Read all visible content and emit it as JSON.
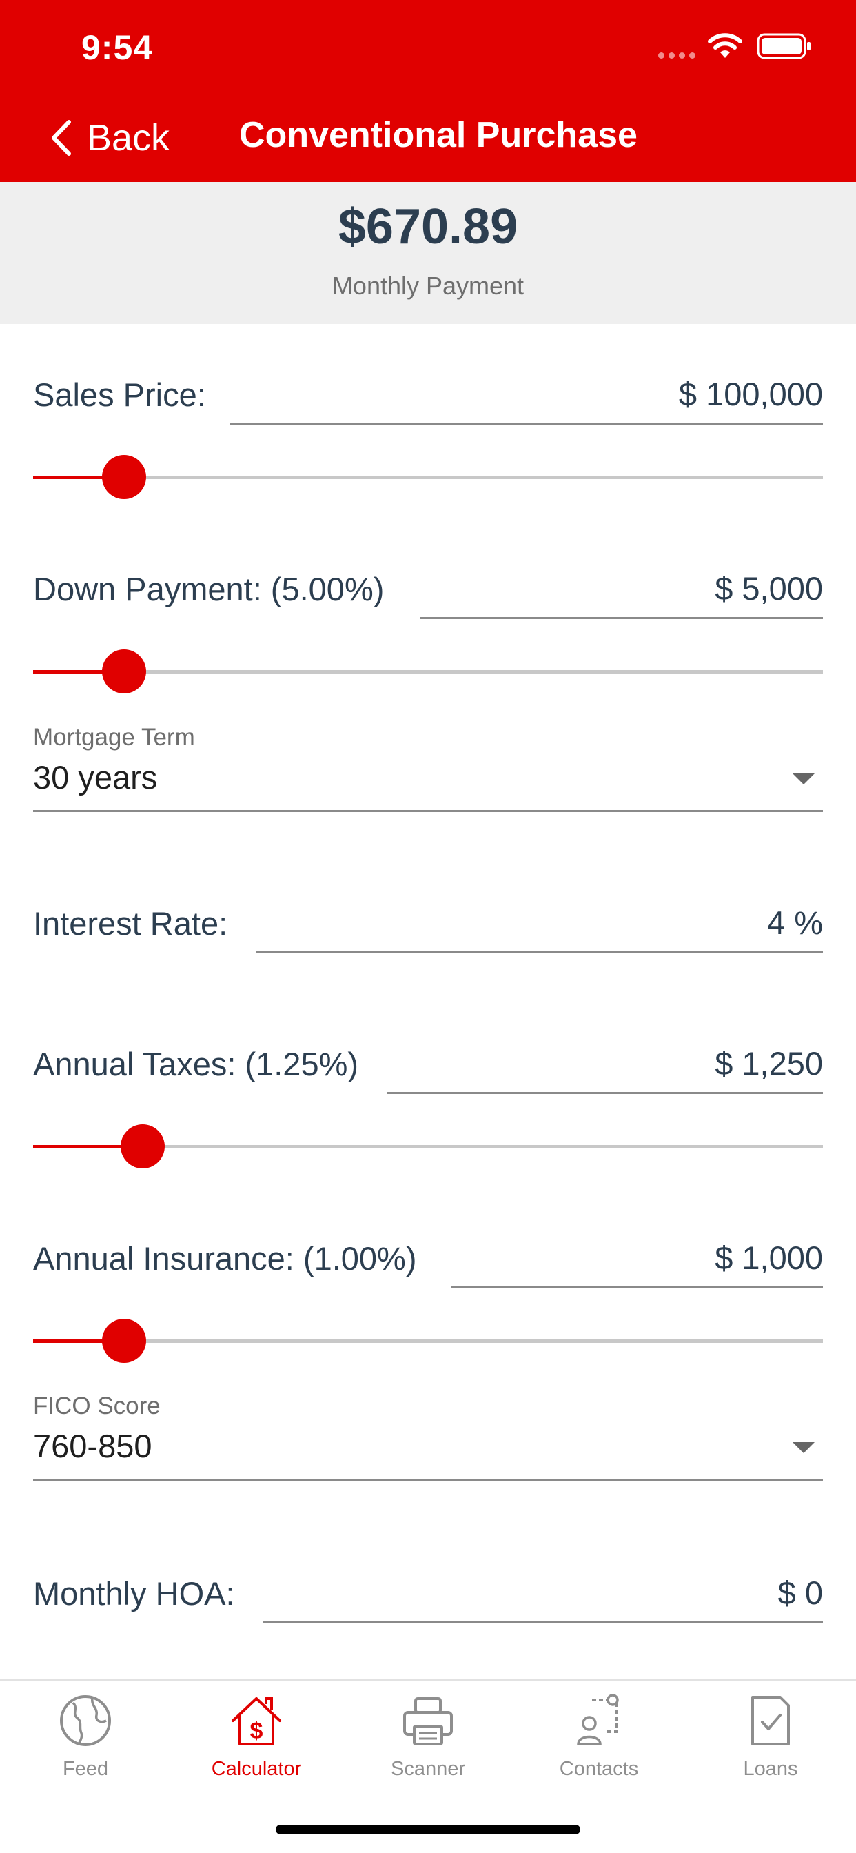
{
  "status_bar": {
    "time": "9:54"
  },
  "nav": {
    "back_label": "Back",
    "title": "Conventional Purchase"
  },
  "summary": {
    "amount": "$670.89",
    "label": "Monthly Payment"
  },
  "fields": {
    "sales_price": {
      "label": "Sales Price:",
      "value": "$ 100,000",
      "slider_fraction": 0.115
    },
    "down_payment": {
      "label": "Down Payment: (5.00%)",
      "value": "$ 5,000",
      "slider_fraction": 0.115
    },
    "mortgage_term": {
      "caption": "Mortgage Term",
      "value": "30 years"
    },
    "interest_rate": {
      "label": "Interest Rate:",
      "value": "4 %"
    },
    "annual_taxes": {
      "label": "Annual Taxes: (1.25%)",
      "value": "$ 1,250",
      "slider_fraction": 0.139
    },
    "annual_insurance": {
      "label": "Annual Insurance: (1.00%)",
      "value": "$ 1,000",
      "slider_fraction": 0.115
    },
    "fico_score": {
      "caption": "FICO Score",
      "value": "760-850"
    },
    "monthly_hoa": {
      "label": "Monthly HOA:",
      "value": "$ 0"
    }
  },
  "tabbar": {
    "tabs": [
      {
        "label": "Feed",
        "icon": "globe-icon",
        "active": false
      },
      {
        "label": "Calculator",
        "icon": "house-dollar-icon",
        "active": true
      },
      {
        "label": "Scanner",
        "icon": "printer-icon",
        "active": false
      },
      {
        "label": "Contacts",
        "icon": "contacts-icon",
        "active": false
      },
      {
        "label": "Loans",
        "icon": "document-check-icon",
        "active": false
      }
    ]
  },
  "colors": {
    "brand_red": "#e00000",
    "text_dark": "#2c3e50",
    "muted": "#8e8e8e"
  }
}
